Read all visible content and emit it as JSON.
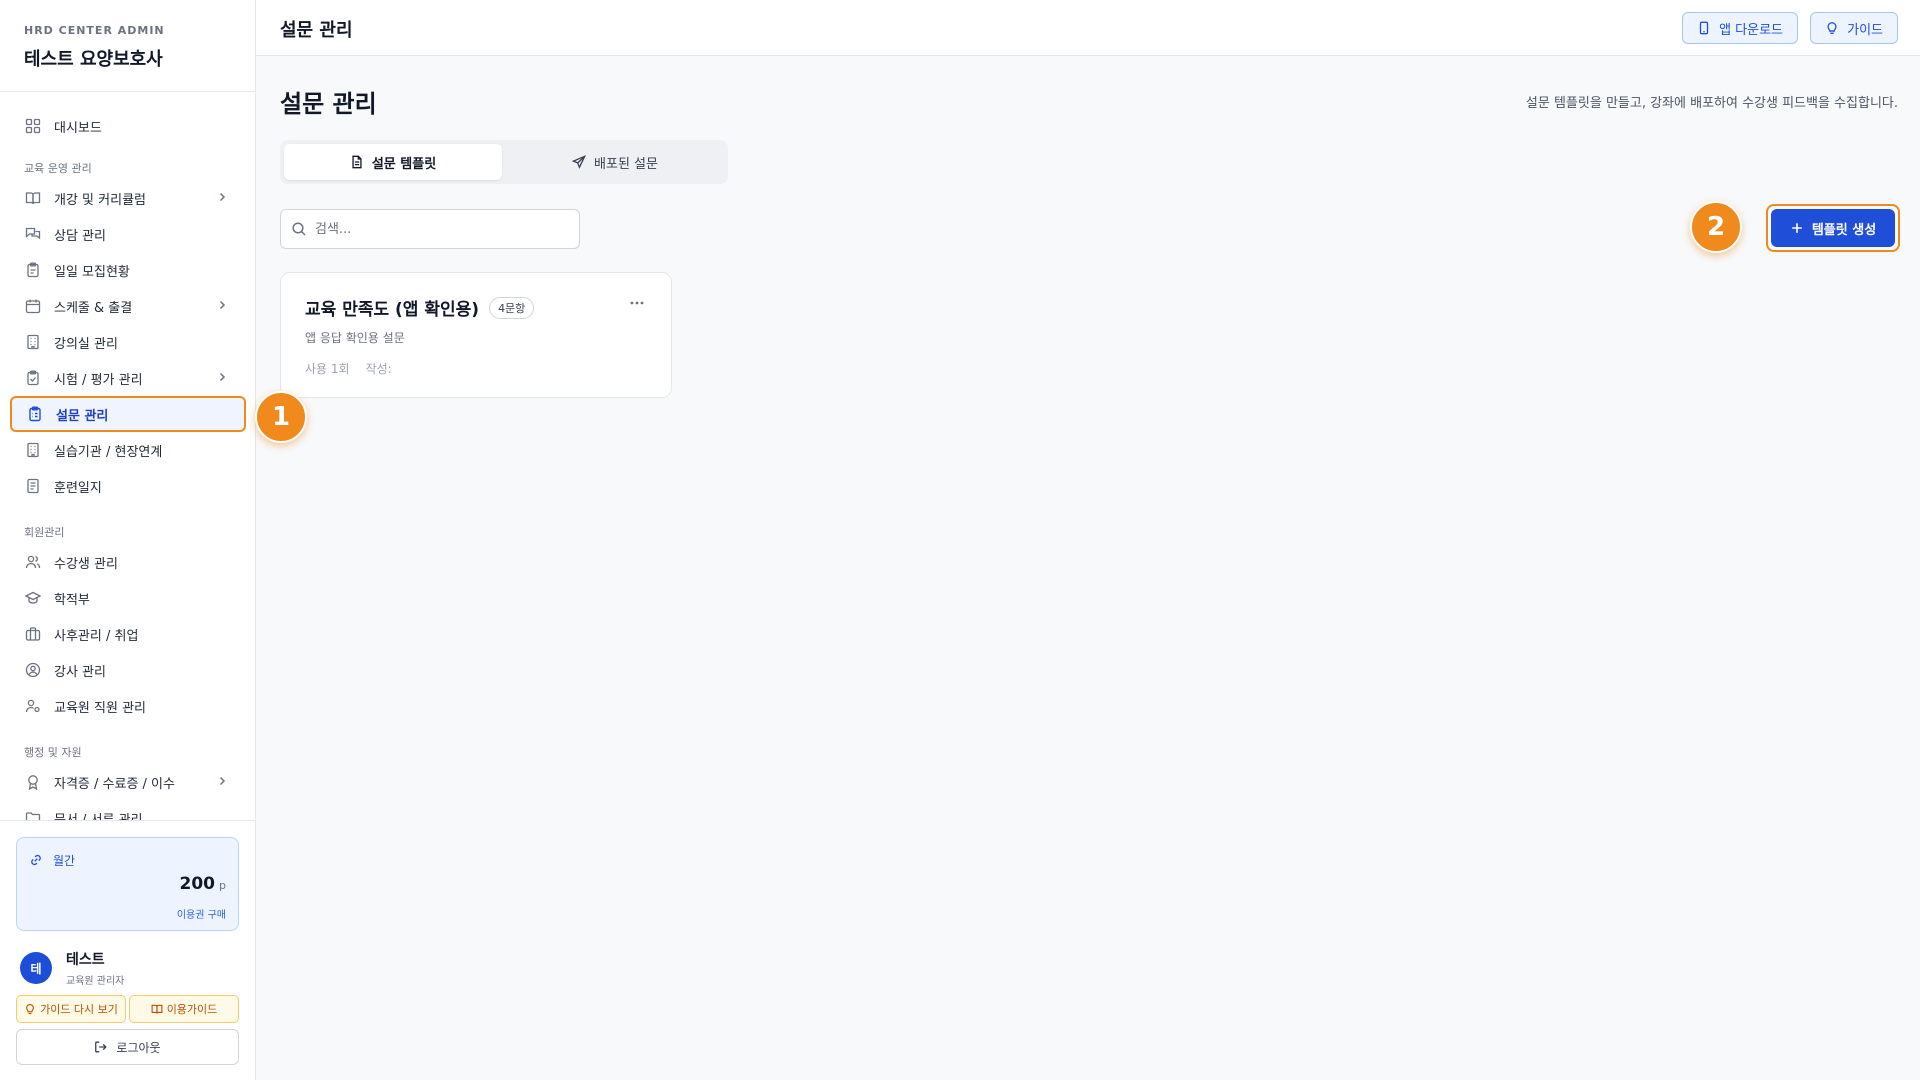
{
  "sidebar": {
    "brand_sub": "HRD CENTER ADMIN",
    "brand_title": "테스트 요양보호사",
    "items": [
      {
        "label": "대시보드",
        "icon": "grid-icon"
      },
      {
        "label": "개강 및 커리큘럼",
        "icon": "book-icon"
      },
      {
        "label": "상담 관리",
        "icon": "chat-icon"
      },
      {
        "label": "일일 모집현황",
        "icon": "clipboard-icon"
      },
      {
        "label": "스케줄 & 출결",
        "icon": "calendar-icon"
      },
      {
        "label": "강의실 관리",
        "icon": "building-icon"
      },
      {
        "label": "시험 / 평가 관리",
        "icon": "clipboard-check-icon"
      },
      {
        "label": "설문 관리",
        "icon": "clipboard-list-icon"
      },
      {
        "label": "실습기관 / 현장연계",
        "icon": "building-icon"
      },
      {
        "label": "훈련일지",
        "icon": "document-icon"
      },
      {
        "label": "수강생 관리",
        "icon": "users-icon"
      },
      {
        "label": "학적부",
        "icon": "graduation-cap-icon"
      },
      {
        "label": "사후관리 / 취업",
        "icon": "briefcase-icon"
      },
      {
        "label": "강사 관리",
        "icon": "user-circle-icon"
      },
      {
        "label": "교육원 직원 관리",
        "icon": "user-cog-icon"
      },
      {
        "label": "자격증 / 수료증 / 이수",
        "icon": "award-icon"
      },
      {
        "label": "문서 / 서류 관리",
        "icon": "folder-icon"
      }
    ],
    "sections": [
      "교육 운영 관리",
      "회원관리",
      "행정 및 자원"
    ],
    "plan": {
      "label": "월간",
      "amount": "200",
      "unit": "p",
      "buy": "이용권 구매"
    },
    "user": {
      "initial": "테",
      "name": "테스트",
      "role": "교육원 관리자"
    },
    "guide_again": "가이드 다시 보기",
    "usage_guide": "이용가이드",
    "logout": "로그아웃"
  },
  "header": {
    "title": "설문 관리",
    "app_download": "앱 다운로드",
    "guide": "가이드"
  },
  "main": {
    "title": "설문 관리",
    "description": "설문 템플릿을 만들고, 강좌에 배포하여 수강생 피드백을 수집합니다.",
    "tabs": [
      {
        "label": "설문 템플릿"
      },
      {
        "label": "배포된 설문"
      }
    ],
    "search_placeholder": "검색...",
    "create_label": "템플릿 생성",
    "card": {
      "title": "교육 만족도 (앱 확인용)",
      "badge": "4문항",
      "description": "앱 응답 확인용 설문",
      "usage": "사용 1회",
      "author": "작성:"
    }
  },
  "annotations": [
    "1",
    "2"
  ],
  "colors": {
    "accent": "#1f4ed8",
    "highlight": "#f08a1c"
  }
}
